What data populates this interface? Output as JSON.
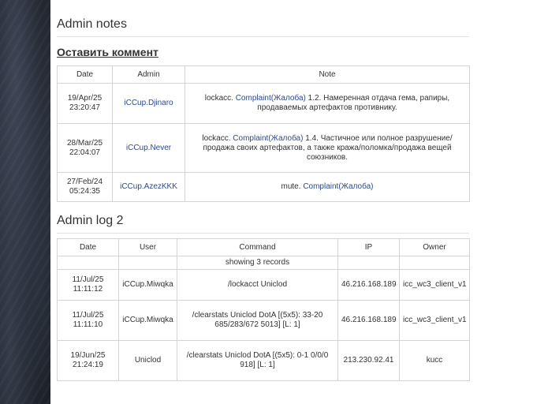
{
  "admin_notes": {
    "title": "Admin notes",
    "comment_link": "Оставить коммент",
    "columns": [
      "Date",
      "Admin",
      "Note"
    ],
    "rows": [
      {
        "date": "19/Apr/25",
        "time": "23:20:47",
        "admin": "iCCup.Djinaro",
        "note_prefix": "lockacc.",
        "note_link": "Complaint(Жалоба)",
        "note_text": "1.2. Намеренная отдача гема, рапиры, продаваемых артефактов противнику."
      },
      {
        "date": "28/Mar/25",
        "time": "22:04:07",
        "admin": "iCCup.Never",
        "note_prefix": "lockacc.",
        "note_link": "Complaint(Жалоба)",
        "note_text": "1.4. Частичное или полное разрушение/продажа своих артефактов, а также кража/поломка/продажа вещей союзников."
      },
      {
        "date": "27/Feb/24",
        "time": "05:24:35",
        "admin": "iCCup.AzezKKK",
        "note_prefix": "mute.",
        "note_link": "Complaint(Жалоба)",
        "note_text": ""
      }
    ]
  },
  "admin_log": {
    "title": "Admin log 2",
    "columns": [
      "Date",
      "User",
      "Command",
      "IP",
      "Owner"
    ],
    "summary": "showing 3 records",
    "rows": [
      {
        "date": "11/Jul/25",
        "time": "11:11:12",
        "user": "iCCup.Miwqka",
        "command": "/lockacct Uniclod",
        "ip": "46.216.168.189",
        "owner": "icc_wc3_client_v1"
      },
      {
        "date": "11/Jul/25",
        "time": "11:11:10",
        "user": "iCCup.Miwqka",
        "command": "/clearstats Uniclod DotA [(5x5): 33-20 685/283/672 5013] [L: 1]",
        "ip": "46.216.168.189",
        "owner": "icc_wc3_client_v1"
      },
      {
        "date": "19/Jun/25",
        "time": "21:24:19",
        "user": "Uniclod",
        "command": "/clearstats Uniclod DotA [(5x5): 0-1 0/0/0 918] [L: 1]",
        "ip": "213.230.92.41",
        "owner": "kucc"
      }
    ]
  },
  "colors": {
    "link": "#2a4a93",
    "border": "#d4d4d4",
    "text": "#333333",
    "sidebar_bg": "#22262f"
  }
}
